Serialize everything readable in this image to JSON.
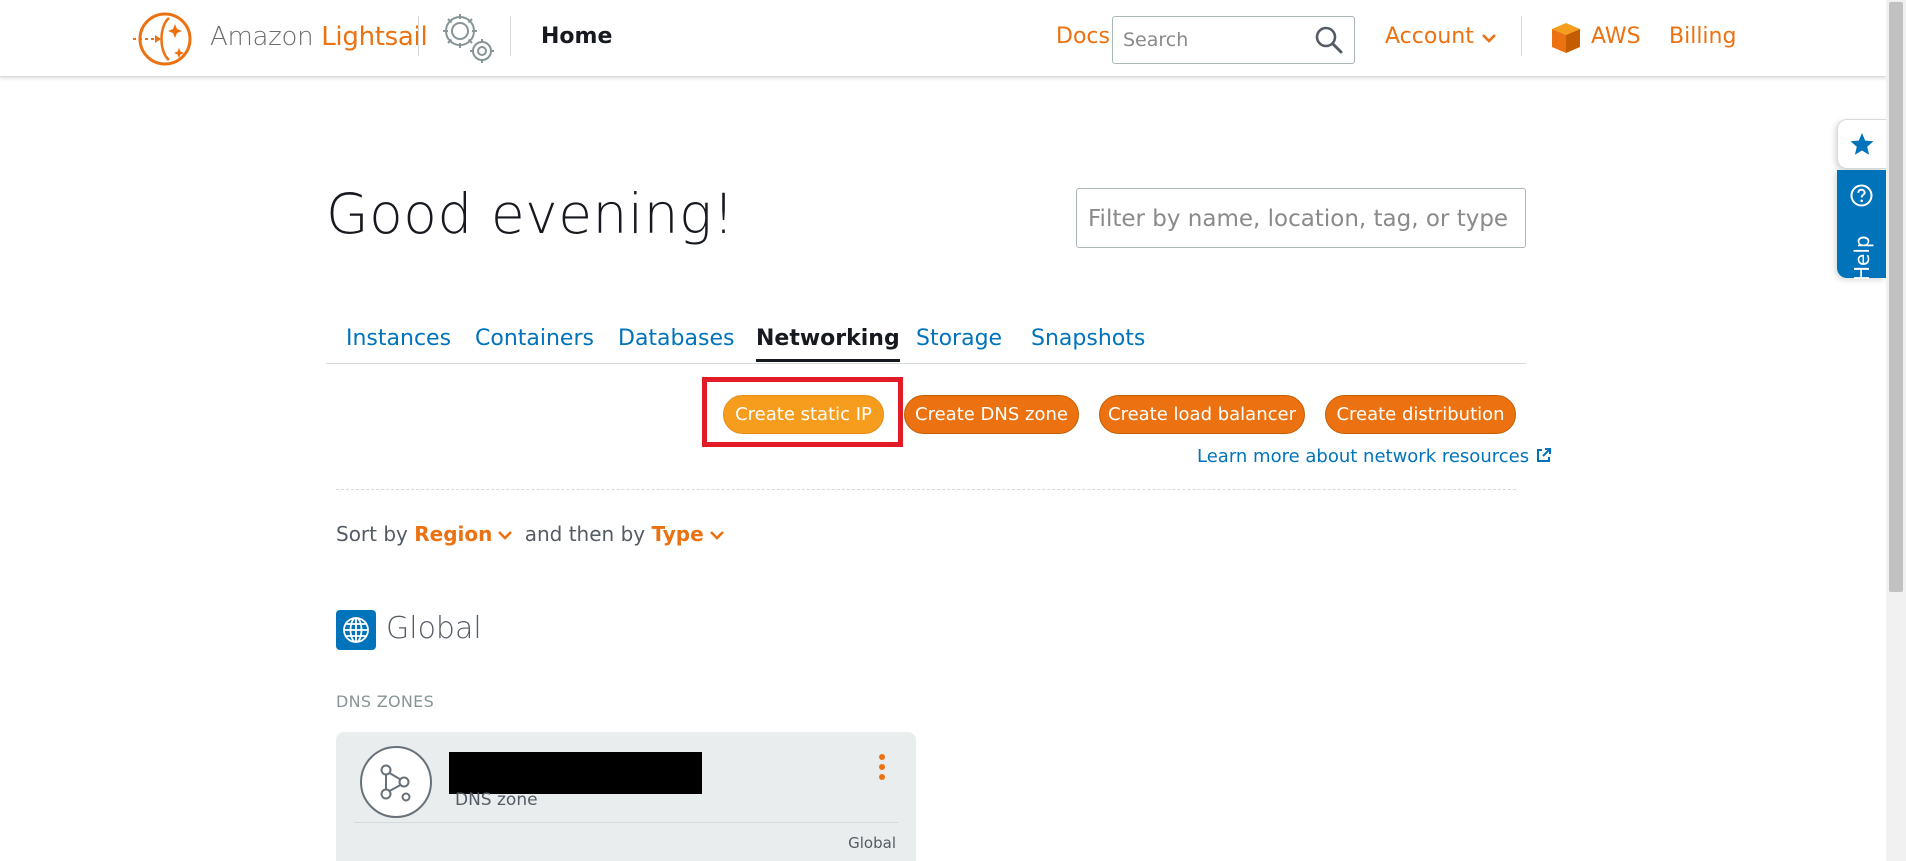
{
  "header": {
    "brand_amazon": "Amazon",
    "brand_lightsail": "Lightsail",
    "home_label": "Home",
    "docs_label": "Docs",
    "search": {
      "placeholder": "Search",
      "value": ""
    },
    "account_label": "Account",
    "aws_label": "AWS",
    "billing_label": "Billing",
    "icons": [
      "lightsail-logo-icon",
      "settings-gears-icon",
      "search-icon",
      "chevron-down-icon",
      "aws-cube-icon"
    ]
  },
  "side_tabs": {
    "favorites_icon": "star-icon",
    "help_label": "Help",
    "help_icon": "question-circle-icon"
  },
  "main": {
    "greeting": "Good evening!",
    "filter": {
      "placeholder": "Filter by name, location, tag, or type",
      "value": ""
    },
    "tabs": [
      {
        "label": "Instances",
        "active": false
      },
      {
        "label": "Containers",
        "active": false
      },
      {
        "label": "Databases",
        "active": false
      },
      {
        "label": "Networking",
        "active": true
      },
      {
        "label": "Storage",
        "active": false
      },
      {
        "label": "Snapshots",
        "active": false
      }
    ],
    "actions": [
      {
        "label": "Create static IP",
        "highlighted": true
      },
      {
        "label": "Create DNS zone",
        "highlighted": false
      },
      {
        "label": "Create load balancer",
        "highlighted": false
      },
      {
        "label": "Create distribution",
        "highlighted": false
      }
    ],
    "learn_more": "Learn more about network resources",
    "sort": {
      "prefix": "Sort by",
      "primary": "Region",
      "middle": "and then by",
      "secondary": "Type"
    },
    "region": {
      "title": "Global",
      "section_label": "DNS ZONES",
      "cards": [
        {
          "name": "",
          "redacted": true,
          "type": "DNS zone",
          "region": "Global"
        }
      ]
    }
  },
  "colors": {
    "accent_orange": "#ec7211",
    "highlight_orange": "#f79d1d",
    "link_blue": "#0073bb",
    "annotation_red": "#e11c27"
  }
}
